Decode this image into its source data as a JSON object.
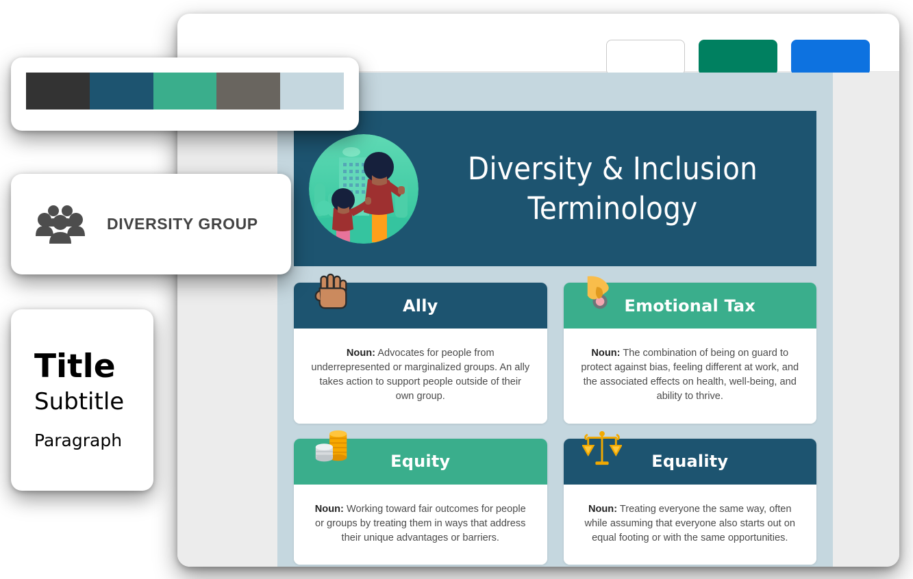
{
  "window": {
    "toolbar": {
      "buttons": [
        {
          "name": "secondary-button",
          "label": "",
          "color": "#ffffff"
        },
        {
          "name": "primary-green-button",
          "label": "",
          "color": "#008060"
        },
        {
          "name": "primary-blue-button",
          "label": "",
          "color": "#0d72e0"
        }
      ]
    }
  },
  "poster": {
    "title_line1": "Diversity & Inclusion",
    "title_line2": "Terminology",
    "header_bg": "#1d5470",
    "canvas_bg": "#c5d7df",
    "illustration": "adult-and-child-cityscape-illustration",
    "cards": [
      {
        "term": "Ally",
        "icon": "raised-fist-icon",
        "icon_glyph": "✊🏽",
        "head_color": "#1d5470",
        "part_of_speech": "Noun:",
        "definition": " Advocates for people from underrepresented or marginalized groups. An ally takes action to support people outside of their own group."
      },
      {
        "term": "Emotional Tax",
        "icon": "hand-with-coin-icon",
        "icon_glyph": "🤏",
        "head_color": "#3aae8c",
        "part_of_speech": "Noun:",
        "definition": " The combination of being on guard to protect against bias, feeling different at work, and the associated effects on health, well-being, and ability to thrive."
      },
      {
        "term": "Equity",
        "icon": "coin-stacks-icon",
        "icon_glyph": "🪙",
        "head_color": "#3aae8c",
        "part_of_speech": "Noun:",
        "definition": " Working toward fair outcomes for people or groups by treating them in ways that address their unique advantages or barriers."
      },
      {
        "term": "Equality",
        "icon": "balance-scales-icon",
        "icon_glyph": "⚖️",
        "head_color": "#1d5470",
        "part_of_speech": "Noun:",
        "definition": " Treating everyone the same way, often while assuming that everyone also starts out on equal footing or with the same opportunities."
      }
    ]
  },
  "palette": {
    "colors": [
      "#333333",
      "#1d5470",
      "#3aae8c",
      "#69655f",
      "#c5d7df"
    ]
  },
  "logo": {
    "icon": "group-of-people-icon",
    "name": "DIVERSITY GROUP"
  },
  "typography": {
    "title": "Title",
    "subtitle": "Subtitle",
    "paragraph": "Paragraph"
  }
}
